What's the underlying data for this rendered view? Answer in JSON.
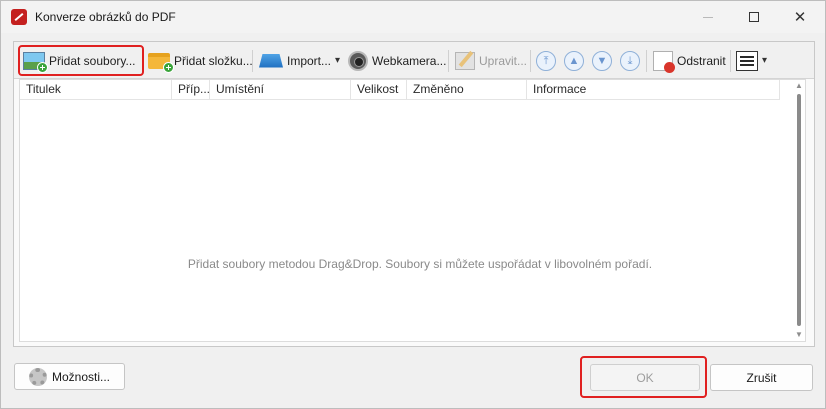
{
  "window": {
    "title": "Konverze obrázků do PDF",
    "icon": "pdf-app-icon",
    "controls": {
      "minimize": "minimize",
      "maximize": "maximize",
      "close": "✕"
    }
  },
  "toolbar": {
    "add_files": "Přidat soubory...",
    "add_folder": "Přidat složku...",
    "import": "Import...",
    "webcam": "Webkamera...",
    "edit": "Upravit...",
    "move_top_glyph": "⤒",
    "move_up_glyph": "▲",
    "move_down_glyph": "▼",
    "move_bottom_glyph": "⤓",
    "remove": "Odstranit",
    "view_chevron": "▾",
    "import_chevron": "▾"
  },
  "columns": [
    "Titulek",
    "Příp...",
    "Umístění",
    "Velikost",
    "Změněno",
    "Informace"
  ],
  "list": {
    "empty_hint": "Přidat soubory metodou Drag&Drop. Soubory si můžete uspořádat v libovolném pořadí."
  },
  "scrollbar": {
    "up": "▲",
    "down": "▼"
  },
  "footer": {
    "options": "Možnosti...",
    "ok": "OK",
    "cancel": "Zrušit"
  },
  "colors": {
    "highlight": "#e02020",
    "window_bg": "#f0f0f0",
    "title_icon": "#c4201f"
  }
}
